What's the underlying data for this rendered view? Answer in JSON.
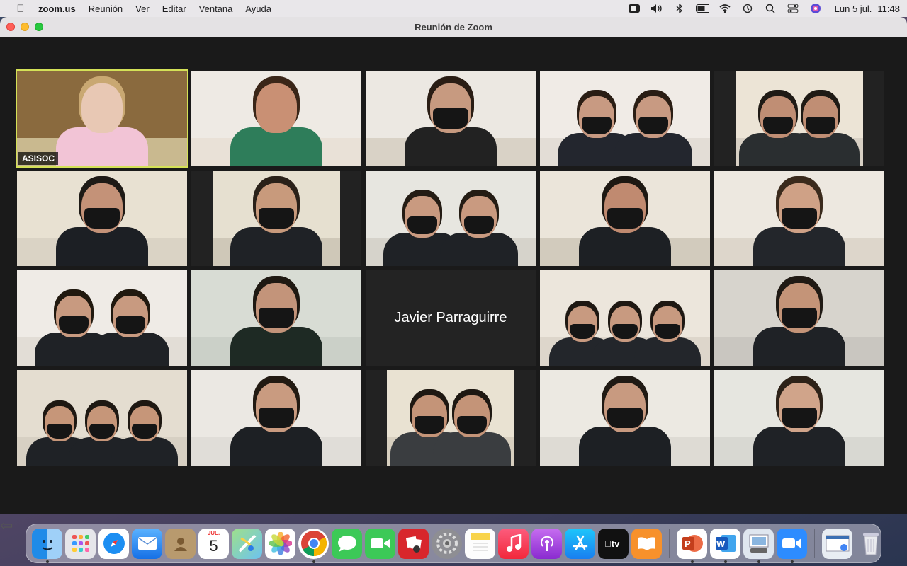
{
  "menubar": {
    "app_name": "zoom.us",
    "menus": [
      "Reunión",
      "Ver",
      "Editar",
      "Ventana",
      "Ayuda"
    ],
    "date": "Lun 5 jul.",
    "time": "11:48",
    "status_icons": [
      "camera-icon",
      "volume-icon",
      "bluetooth-icon",
      "battery-icon",
      "wifi-icon",
      "time-machine-icon",
      "search-icon",
      "control-center-icon",
      "siri-icon"
    ]
  },
  "window": {
    "title": "Reunión de Zoom"
  },
  "participants": [
    {
      "name": "ASISOC",
      "show_name": true,
      "active": true,
      "video": true
    },
    {
      "video": true
    },
    {
      "video": true
    },
    {
      "video": true
    },
    {
      "video": true
    },
    {
      "video": true
    },
    {
      "video": true
    },
    {
      "video": true
    },
    {
      "video": true
    },
    {
      "video": true
    },
    {
      "video": true
    },
    {
      "video": true
    },
    {
      "name": "Javier Parraguirre",
      "video": false
    },
    {
      "video": true
    },
    {
      "video": true
    },
    {
      "video": true
    },
    {
      "video": true
    },
    {
      "video": true
    },
    {
      "video": true
    },
    {
      "video": true
    }
  ],
  "dock": {
    "calendar": {
      "month": "JUL.",
      "day": "5"
    },
    "apps": [
      "finder",
      "launchpad",
      "safari",
      "mail",
      "contacts",
      "calendar",
      "maps",
      "photos",
      "chrome",
      "messages",
      "facetime",
      "photo-booth",
      "system-preferences",
      "notes",
      "music",
      "podcasts",
      "app-store",
      "apple-tv",
      "books",
      "powerpoint",
      "word",
      "preview",
      "zoom",
      "downloads",
      "trash"
    ]
  }
}
